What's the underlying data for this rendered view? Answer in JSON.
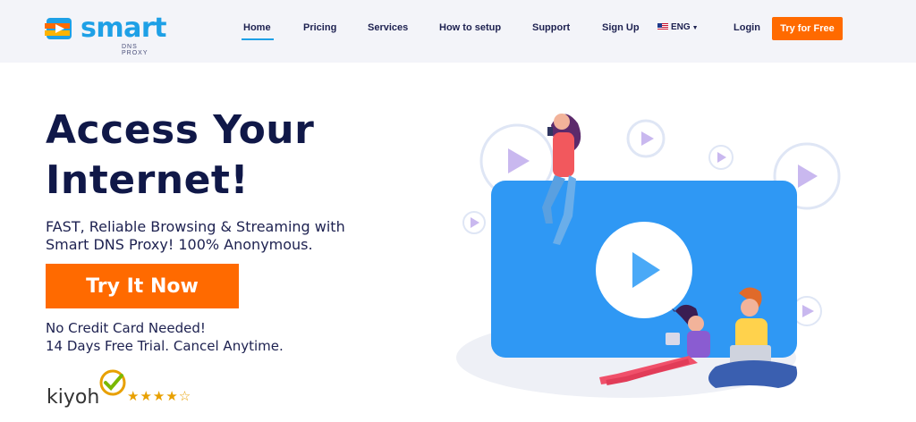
{
  "brand": {
    "name": "smart",
    "tagline": "DNS PROXY"
  },
  "nav": {
    "items": [
      {
        "label": "Home",
        "active": true
      },
      {
        "label": "Pricing"
      },
      {
        "label": "Services"
      },
      {
        "label": "How to setup"
      },
      {
        "label": "Support"
      },
      {
        "label": "Sign Up"
      }
    ],
    "language": "ENG",
    "login": "Login",
    "cta": "Try for Free"
  },
  "hero": {
    "title": "Access Your Internet!",
    "subtitle": "FAST, Reliable Browsing & Streaming with Smart DNS Proxy! 100% Anonymous.",
    "cta": "Try It Now",
    "note_line1": "No Credit Card Needed!",
    "note_line2": "14 Days Free Trial. Cancel Anytime."
  },
  "rating": {
    "brand": "kiyoh",
    "stars": "★★★★☆"
  },
  "colors": {
    "accent": "#ff6a00",
    "brand_blue": "#1ea0e6",
    "heading": "#101848",
    "player_blue": "#2f98f4"
  }
}
